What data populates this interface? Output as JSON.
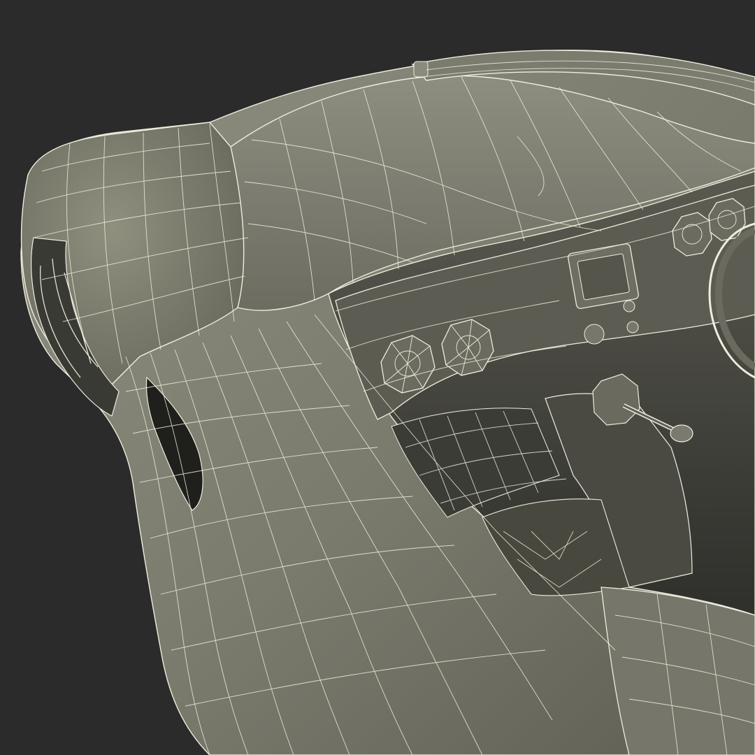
{
  "colors": {
    "background": "#2b2b2b",
    "surface_light": "#8a8a7c",
    "surface_mid": "#6f6f63",
    "surface_dark": "#4e4e46",
    "cavity": "#34342f",
    "wire": "#f2efe0"
  },
  "icons": {
    "gauge": "octagon-gauge-icon",
    "screen": "dashboard-display-icon",
    "lever": "gear-shift-icon"
  }
}
